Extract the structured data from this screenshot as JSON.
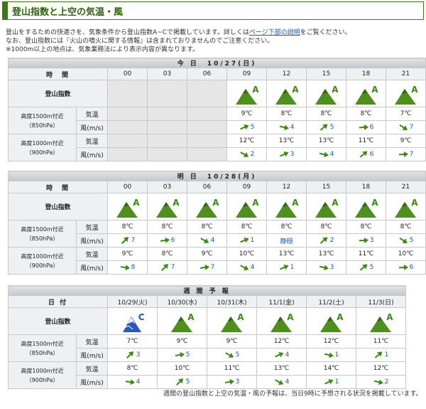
{
  "title": "登山指数と上空の気温・風",
  "intro": {
    "line1_a": "登山をするための快適さを、気象条件から登山指数A~Cで掲載しています。詳しくは",
    "line1_link": "ページ下部の説明",
    "line1_b": "をご覧ください。",
    "line2": "なお、登山指数には『火山の噴火に関する情報』は含まれておりませんのでご注意ください。",
    "line3": "※1000m以上の地点は、気象業務法により表示内容が異なります。"
  },
  "labels": {
    "time": "時　間",
    "date": "日 付",
    "index": "登山指数",
    "alt1500a": "高度1500m付近",
    "alt1500b": "（850hPa）",
    "alt1000a": "高度1000m付近",
    "alt1000b": "（900hPa）",
    "temp": "気温",
    "wind": "風(m/s)",
    "calm": "静穏"
  },
  "today": {
    "header": "今 日　10/27(日)",
    "times": [
      "00",
      "03",
      "06",
      "09",
      "12",
      "15",
      "18",
      "21"
    ],
    "grades": [
      "",
      "",
      "",
      "A",
      "A",
      "A",
      "A",
      "A"
    ],
    "t1500": [
      "",
      "",
      "",
      "9℃",
      "8℃",
      "8℃",
      "8℃",
      "7℃"
    ],
    "w1500": [
      "",
      "",
      "",
      "5",
      "4",
      "5",
      "6",
      "7"
    ],
    "t1000": [
      "",
      "",
      "",
      "12℃",
      "13℃",
      "13℃",
      "11℃",
      "9℃"
    ],
    "w1000": [
      "",
      "",
      "",
      "2",
      "3",
      "4",
      "6",
      "7"
    ]
  },
  "tomorrow": {
    "header": "明 日　10/28(月)",
    "times": [
      "00",
      "03",
      "06",
      "09",
      "12",
      "15",
      "18",
      "21"
    ],
    "grades": [
      "A",
      "A",
      "A",
      "A",
      "A",
      "A",
      "A",
      "A"
    ],
    "t1500": [
      "8℃",
      "8℃",
      "8℃",
      "8℃",
      "8℃",
      "8℃",
      "8℃",
      "8℃"
    ],
    "w1500": [
      "7",
      "6",
      "4",
      "1",
      "静穏",
      "2",
      "3",
      "5"
    ],
    "t1000": [
      "9℃",
      "8℃",
      "9℃",
      "10℃",
      "13℃",
      "13℃",
      "11℃",
      "10℃"
    ],
    "w1000": [
      "8",
      "7",
      "7",
      "4",
      "1",
      "3",
      "5",
      "6"
    ]
  },
  "weekly": {
    "header": "週 間 予 報",
    "dates": [
      "10/29(火)",
      "10/30(水)",
      "10/31(木)",
      "11/1(金)",
      "11/2(土)",
      "11/3(日)"
    ],
    "grades": [
      "C",
      "A",
      "A",
      "A",
      "A",
      "A"
    ],
    "t1500": [
      "7℃",
      "9℃",
      "9℃",
      "12℃",
      "12℃",
      "11℃"
    ],
    "w1500": [
      "3",
      "5",
      "5",
      "4",
      "1",
      "1"
    ],
    "t1000": [
      "8℃",
      "10℃",
      "11℃",
      "13℃",
      "14℃",
      "12℃"
    ],
    "w1000": [
      "4",
      "5",
      "3",
      "4",
      "1",
      "2"
    ]
  },
  "footnote": "週間の登山指数と上空の気温・風の予報は、当日9時に予想される状況を掲載しています。",
  "colors": {
    "accent": "#3d7a14",
    "link": "#1a56c4",
    "grade_a": "#3a8a12",
    "grade_c": "#1a56c4"
  }
}
